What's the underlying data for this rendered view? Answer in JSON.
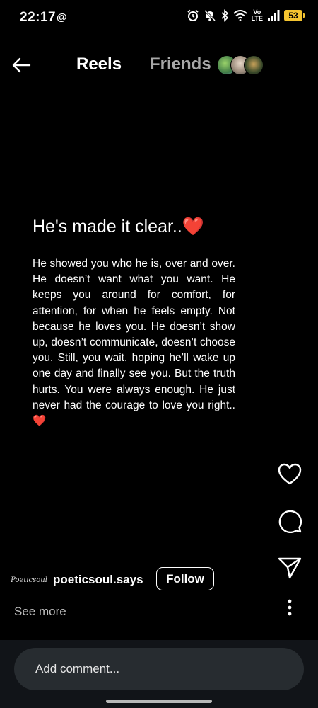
{
  "status_bar": {
    "time": "22:17",
    "threads_glyph": "@",
    "volte_top": "Vo",
    "volte_bottom": "LTE",
    "battery": "53",
    "icons": [
      "alarm-icon",
      "mute-icon",
      "bluetooth-icon",
      "wifi-icon",
      "signal-icon",
      "battery-icon"
    ]
  },
  "top_nav": {
    "back_icon": "back-arrow-icon",
    "tabs": [
      {
        "label": "Reels",
        "active": true
      },
      {
        "label": "Friends",
        "active": false
      }
    ]
  },
  "reel": {
    "title": "He's made it clear..❤️",
    "body": "He showed you who he is, over and over. He doesn’t want what you want. He keeps you around for comfort, for attention, for when he feels empty. Not because he loves you. He doesn’t show up, doesn’t communicate, doesn’t choose you. Still, you wait, hoping he’ll wake up one day and finally see you. But the truth hurts. You were always enough. He just never had the courage to love you right..❤️"
  },
  "actions": {
    "icons": [
      "heart-icon",
      "comment-icon",
      "send-icon",
      "more-vertical-icon"
    ]
  },
  "author": {
    "avatar_text": "Poeticsoul",
    "username": "poeticsoul.says",
    "follow_label": "Follow"
  },
  "caption": {
    "see_more": "See more"
  },
  "comment": {
    "placeholder": "Add comment..."
  },
  "colors": {
    "background": "#000000",
    "inactive_tab": "#a8a8a8",
    "battery": "#f4c430",
    "comment_bar": "#272c30",
    "bottom_area": "#111418"
  }
}
